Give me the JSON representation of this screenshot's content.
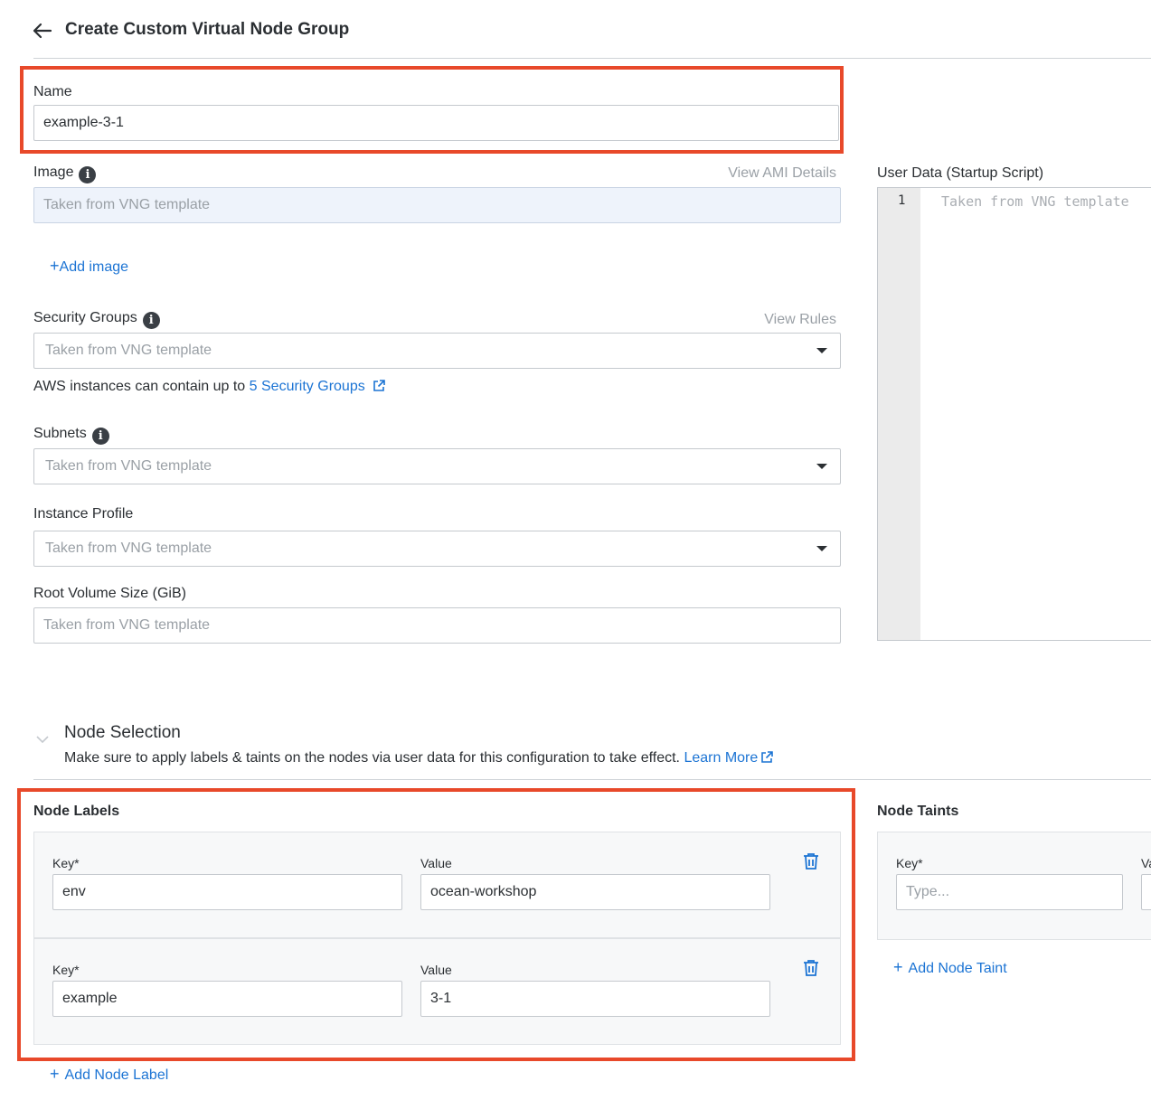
{
  "header": {
    "title": "Create Custom Virtual Node Group"
  },
  "name": {
    "label": "Name",
    "value": "example-3-1"
  },
  "image": {
    "label": "Image",
    "link": "View AMI Details",
    "placeholder": "Taken from VNG template",
    "add_label": "Add image"
  },
  "security_groups": {
    "label": "Security Groups",
    "link": "View Rules",
    "placeholder": "Taken from VNG template",
    "hint_prefix": "AWS instances can contain up to",
    "hint_link": "5 Security Groups"
  },
  "subnets": {
    "label": "Subnets",
    "placeholder": "Taken from VNG template"
  },
  "instance_profile": {
    "label": "Instance Profile",
    "placeholder": "Taken from VNG template"
  },
  "root_volume": {
    "label": "Root Volume Size (GiB)",
    "placeholder": "Taken from VNG template"
  },
  "user_data": {
    "label": "User Data (Startup Script)",
    "line_number": "1",
    "placeholder": "Taken from VNG template"
  },
  "node_selection": {
    "title": "Node Selection",
    "description": "Make sure to apply labels & taints on the nodes via user data for this configuration to take effect.",
    "learn_more": "Learn More"
  },
  "node_labels": {
    "title": "Node Labels",
    "key_label": "Key*",
    "value_label": "Value",
    "rows": [
      {
        "key": "env",
        "value": "ocean-workshop"
      },
      {
        "key": "example",
        "value": "3-1"
      }
    ],
    "add_label": "Add Node Label"
  },
  "node_taints": {
    "title": "Node Taints",
    "key_label": "Key*",
    "value_label": "Va",
    "key_placeholder": "Type...",
    "add_label": "Add Node Taint"
  },
  "colors": {
    "accent": "#1c74d4",
    "highlight": "#e8492a"
  }
}
